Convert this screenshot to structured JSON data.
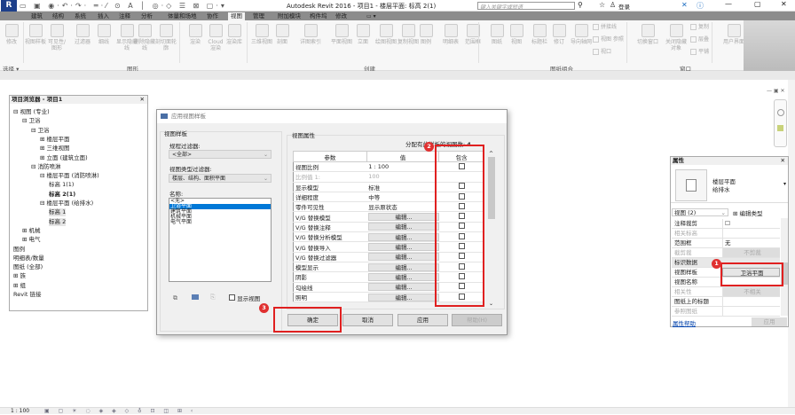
{
  "app": {
    "title": "Autodesk Revit 2016 -    项目1 - 楼层平面: 标高 2(1)",
    "search_placeholder": "键入关键字或短语",
    "login": "登录",
    "accent": "#0078d7"
  },
  "tabs": [
    "建筑",
    "结构",
    "系统",
    "插入",
    "注释",
    "分析",
    "体量和场地",
    "协作",
    "视图",
    "管理",
    "附加模块",
    "构件坞",
    "修改"
  ],
  "active_tab": "视图",
  "ribbon": {
    "buttons": [
      "修改",
      "视图样板",
      "可见性/图形",
      "过滤器",
      "细线",
      "显示隐藏线",
      "删除隐藏线",
      "剖切面轮廓",
      "渲染",
      "Cloud 渲染",
      "渲染库",
      "三维视图",
      "剖面",
      "详图索引",
      "平面视图",
      "立面",
      "绘图视图",
      "复制视图",
      "图例",
      "明细表",
      "范围框",
      "图纸",
      "视图",
      "标题栏",
      "修订",
      "导向轴网",
      "拼接线",
      "视图 参照",
      "视口",
      "切换窗口",
      "关闭隐藏对象",
      "复制",
      "层叠",
      "平铺",
      "用户界面"
    ],
    "panels": [
      "选择 ▾",
      "图形",
      "创建",
      "图纸组合",
      "窗口"
    ]
  },
  "browser": {
    "title": "项目浏览器 - 项目1",
    "items": [
      {
        "label": "⊟ 视图 (专业)",
        "level": 0
      },
      {
        "label": "⊟ 卫浴",
        "level": 1
      },
      {
        "label": "⊟ 卫浴",
        "level": 2
      },
      {
        "label": "⊞ 楼层平面",
        "level": 3
      },
      {
        "label": "⊞ 三维视图",
        "level": 3
      },
      {
        "label": "⊞ 立面 (建筑立面)",
        "level": 3
      },
      {
        "label": "⊟ 消防喷淋",
        "level": 2
      },
      {
        "label": "⊟ 楼层平面 (消防喷淋)",
        "level": 3
      },
      {
        "label": "标高 1(1)",
        "level": 4
      },
      {
        "label": "标高 2(1)",
        "level": 4,
        "bold": true
      },
      {
        "label": "⊟ 楼层平面 (给排水)",
        "level": 3
      },
      {
        "label": "标高 1",
        "level": 4,
        "selected": true
      },
      {
        "label": "标高 2",
        "level": 4,
        "selected": true
      },
      {
        "label": "⊞ 机械",
        "level": 1
      },
      {
        "label": "⊞ 电气",
        "level": 1
      },
      {
        "label": "图例",
        "level": 0
      },
      {
        "label": "明细表/数量",
        "level": 0
      },
      {
        "label": "图纸 (全部)",
        "level": 0
      },
      {
        "label": "⊞ 族",
        "level": 0
      },
      {
        "label": "⊞ 组",
        "level": 0
      },
      {
        "label": "Revit 链接",
        "level": 0
      }
    ]
  },
  "dialog": {
    "title": "应用视图样板",
    "left_group": "视图样板",
    "discipline_label": "规程过滤器:",
    "discipline_value": "<全部>",
    "viewtype_label": "视图类型过滤器:",
    "viewtype_value": "楼层、结构、面积平面",
    "names_label": "名称:",
    "names": [
      "<无>",
      "卫浴平面",
      "建筑平面",
      "机械平面",
      "电气平面"
    ],
    "selected_name": "卫浴平面",
    "show_views_label": "显示视图",
    "right_group": "视图属性",
    "assigned_count_label": "分配有此样板的视图数:",
    "assigned_count": "4",
    "columns": [
      "参数",
      "值",
      "包含"
    ],
    "rows": [
      {
        "param": "视图比例",
        "value": "1 : 100",
        "include": true
      },
      {
        "param": "比例值 1:",
        "value": "100",
        "include": false,
        "dim": true
      },
      {
        "param": "显示模型",
        "value": "标准",
        "include": true
      },
      {
        "param": "详细程度",
        "value": "中等",
        "include": true
      },
      {
        "param": "零件可见性",
        "value": "显示原状态",
        "include": true
      },
      {
        "param": "V/G 替换模型",
        "value": "编辑...",
        "button": true,
        "include": true
      },
      {
        "param": "V/G 替换注释",
        "value": "编辑...",
        "button": true,
        "include": true
      },
      {
        "param": "V/G 替换分析模型",
        "value": "编辑...",
        "button": true,
        "include": true
      },
      {
        "param": "V/G 替换导入",
        "value": "编辑...",
        "button": true,
        "include": true
      },
      {
        "param": "V/G 替换过滤器",
        "value": "编辑...",
        "button": true,
        "include": true
      },
      {
        "param": "模型显示",
        "value": "编辑...",
        "button": true,
        "include": true
      },
      {
        "param": "阴影",
        "value": "编辑...",
        "button": true,
        "include": true
      },
      {
        "param": "勾绘线",
        "value": "编辑...",
        "button": true,
        "include": true
      },
      {
        "param": "照明",
        "value": "编辑...",
        "button": true,
        "include": true
      }
    ],
    "ok": "确定",
    "cancel": "取消",
    "apply": "应用",
    "help": "帮助(H)"
  },
  "properties": {
    "title": "属性",
    "type_name": "楼层平面",
    "type_sub": "给排水",
    "instance_filter": "视图 (2)",
    "edit_type": "编辑类型",
    "rows": [
      {
        "k": "注释裁剪",
        "v": "☐"
      },
      {
        "k": "相关标高",
        "v": "",
        "dim": true
      },
      {
        "k": "范围框",
        "v": "无"
      },
      {
        "k": "截剪裁",
        "v": "不剪裁",
        "dim": true
      },
      {
        "k": "标识数据",
        "v": "",
        "section": true
      },
      {
        "k": "视图样板",
        "v": "卫浴平面",
        "button": true
      },
      {
        "k": "视图名称",
        "v": ""
      },
      {
        "k": "相关性",
        "v": "不相关",
        "dim": true
      },
      {
        "k": "图纸上的标题",
        "v": ""
      },
      {
        "k": "参照图纸",
        "v": "",
        "dim": true
      }
    ],
    "help_link": "属性帮助",
    "apply": "应用"
  },
  "badges": [
    "1",
    "2",
    "3"
  ],
  "status": {
    "scale": "1 : 100"
  }
}
